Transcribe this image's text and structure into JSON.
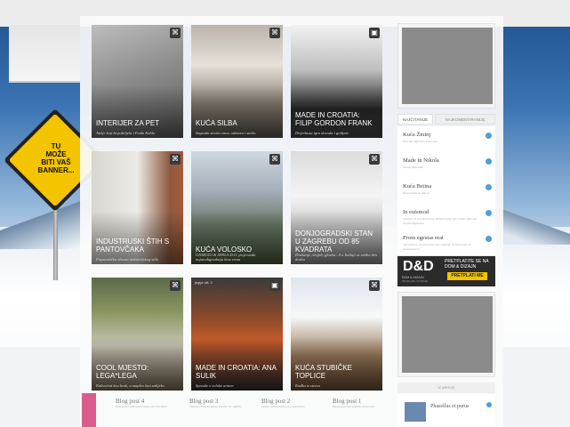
{
  "sign": {
    "text": "TU\nMOŽE\nBITI VAŠ\nBANNER..."
  },
  "tiles": [
    {
      "title": "INTERIJER ZA PET",
      "subtitle": "Atelje koji bi poželjela i Frida Kahlo",
      "meta": "",
      "corner_icon": "armchair-icon"
    },
    {
      "title": "KUĆA SILBA",
      "subtitle": "Sagrada stroba sirca, odmora i strela",
      "meta": "",
      "corner_icon": "armchair-icon"
    },
    {
      "title": "MADE IN CROATIA: FILIP GORDON FRANK",
      "subtitle": "Drijetlasta igra dovoda i golijate",
      "meta": "",
      "corner_icon": "frame-icon"
    },
    {
      "title": "INDUSTRUSKI ŠTIH S PANTOVČAKA",
      "subtitle": "Elajstanščka obraza industrijskog stila",
      "meta": "",
      "corner_icon": "armchair-icon"
    },
    {
      "title": "KUĆA VOLOSKO",
      "subtitle": "GIORGIO & SPELA D.O. prijevozdu najaredignodnija kroz zrata",
      "meta": "",
      "corner_icon": "armchair-icon"
    },
    {
      "title": "DONJOGRADSKI STAN U ZAGREBU OD 85 KVADRATA",
      "subtitle": "Drukanje, sesjidi, glazba...A u Italiuji se smiho den dozba",
      "meta": "",
      "corner_icon": "armchair-icon"
    },
    {
      "title": "COOL MJESTO: LEGA*LEGA",
      "subtitle": "Kakvoćnti kao krub, a mapleo kao salijeko",
      "meta": "",
      "corner_icon": "armchair-icon"
    },
    {
      "title": "MADE IN CROATIA: ANA SULIK",
      "subtitle": "Spraske s voloke armen",
      "meta": "jeglja ulil, 2",
      "corner_icon": "frame-icon"
    },
    {
      "title": "KUĆA STUBIČKE TOPLICE",
      "subtitle": "Kuđka iz sterea",
      "meta": "",
      "corner_icon": "armchair-icon"
    }
  ],
  "sidebar": {
    "tabs": [
      "NAJČITANIJE",
      "NAJKOMENTIRANIJE"
    ],
    "items": [
      {
        "title": "Kuća Žminj",
        "sub": "Istarska deprešna sirku žna"
      },
      {
        "title": "Made in Nikola",
        "sub": "Nikola Bakrndić"
      },
      {
        "title": "Kuća Betina",
        "sub": "Prava kuća za odmor"
      },
      {
        "title": "In euismod",
        "sub": "Quisque in tincidunt eros. Pellentesque nec ornare felis sed iaculis dignissim"
      },
      {
        "title": "Proin egestas erat",
        "sub": "Sed lobortis est ante felis non eleifend. Pellentesque en euismod arcu"
      }
    ],
    "banner": {
      "logo": "D&D",
      "name": "DOM & DIZAJN",
      "tagline": "REVELANL SONNAE",
      "promo": "PRETPLATITE SE NA DOM & DIZAJN",
      "button": "PRETPLATI ME"
    },
    "archive_head": "IZ ARHIVE",
    "archive_item": "Phasellus et purus"
  },
  "blog_posts": [
    {
      "title": "Blog post 4",
      "sub": "Praesent a bibendum nulla, nisi tincidunt"
    },
    {
      "title": "Blog post 3",
      "sub": "Vivamus blandit ipsum mauris, ac sagittis"
    },
    {
      "title": "Blog post 2",
      "sub": "Donec sollicitudin eros elementum"
    },
    {
      "title": "Blog post 1",
      "sub": "Etiam placerat sagittis tortor non"
    }
  ]
}
